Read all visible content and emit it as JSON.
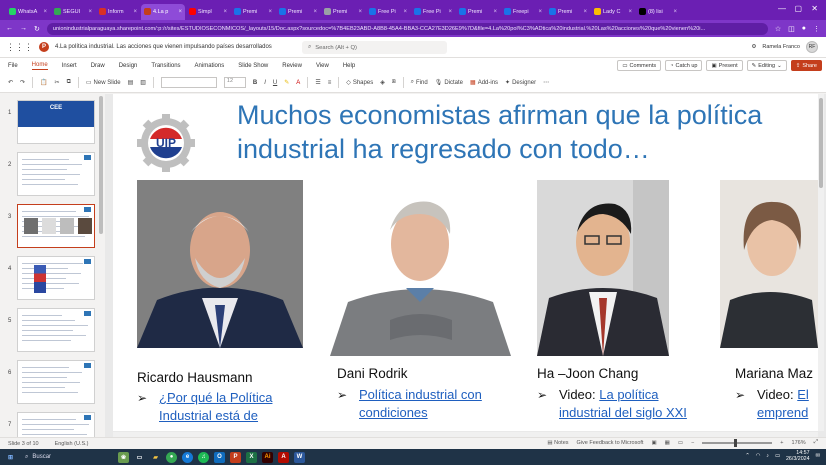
{
  "browser": {
    "tabs": [
      {
        "label": "WhatsA",
        "color": "#25d366"
      },
      {
        "label": "SEGUI",
        "color": "#34a853"
      },
      {
        "label": "Inform",
        "color": "#d93025"
      },
      {
        "label": "4.La p",
        "color": "#c43e1c",
        "active": true
      },
      {
        "label": "Simpl",
        "color": "#ff0000"
      },
      {
        "label": "Premi",
        "color": "#1a73e8"
      },
      {
        "label": "Premi",
        "color": "#1a73e8"
      },
      {
        "label": "Premi",
        "color": "#9aa0a6"
      },
      {
        "label": "Free Pi",
        "color": "#1a73e8"
      },
      {
        "label": "Free Pi",
        "color": "#1a73e8"
      },
      {
        "label": "Premi",
        "color": "#1a73e8"
      },
      {
        "label": "Freepi",
        "color": "#1a73e8"
      },
      {
        "label": "Premi",
        "color": "#1a73e8"
      },
      {
        "label": "Lady C",
        "color": "#fbbc04"
      },
      {
        "label": "(8) lisi",
        "color": "#000000"
      }
    ],
    "url": "unionindustrialparaguaya.sharepoint.com/:p:/r/sites/ESTUDIOSECONMICOS/_layouts/15/Doc.aspx?sourcedoc=%7B4EB23ABD-A8B8-45A4-BBA3-CCA27E3D26E9%7D&file=4.La%20pol%C3%ADtica%20industrial.%20Las%20acciones%20que%20vienen%20i..."
  },
  "office": {
    "doc_title": "4.La política industrial. Las acciones que vienen impulsando países desarrollados",
    "search_placeholder": "Search (Alt + Q)",
    "user_name": "Ramela Franco",
    "user_initials": "RF"
  },
  "menu": {
    "items": [
      "File",
      "Home",
      "Insert",
      "Draw",
      "Design",
      "Transitions",
      "Animations",
      "Slide Show",
      "Review",
      "View",
      "Help"
    ],
    "comments": "Comments",
    "catchup": "Catch up",
    "present": "Present",
    "editing": "Editing",
    "share": "Share"
  },
  "toolbar": {
    "new_slide": "New Slide",
    "font_size": "12",
    "shapes": "Shapes",
    "find": "Find",
    "dictate": "Dictate",
    "addins": "Add-ins",
    "designer": "Designer"
  },
  "thumbnails": [
    {
      "num": "1",
      "title": "CEE"
    },
    {
      "num": "2",
      "title": ""
    },
    {
      "num": "3",
      "title": ""
    },
    {
      "num": "4",
      "title": ""
    },
    {
      "num": "5",
      "title": ""
    },
    {
      "num": "6",
      "title": ""
    },
    {
      "num": "7",
      "title": ""
    }
  ],
  "slide": {
    "title": "Muchos economistas afirman que la política industrial ha regresado con todo…",
    "logo_text": "UIP",
    "people": [
      {
        "name": "Ricardo Hausmann",
        "bullet": "¿Por qué la Política Industrial está de"
      },
      {
        "name": "Dani Rodrik",
        "bullet": "Política industrial con condiciones"
      },
      {
        "name": "Ha –Joon Chang",
        "bullet_prefix": "Video: ",
        "bullet": "La política industrial del siglo XXI"
      },
      {
        "name": "Mariana Maz",
        "bullet_prefix": "Video: ",
        "bullet": "El emprend"
      }
    ]
  },
  "status": {
    "slide_of": "Slide 3 of 10",
    "language": "English (U.S.)",
    "notes": "Notes",
    "feedback": "Give Feedback to Microsoft",
    "zoom": "176%"
  },
  "taskbar": {
    "search": "Buscar",
    "time": "14:57",
    "date": "26/3/2024"
  }
}
